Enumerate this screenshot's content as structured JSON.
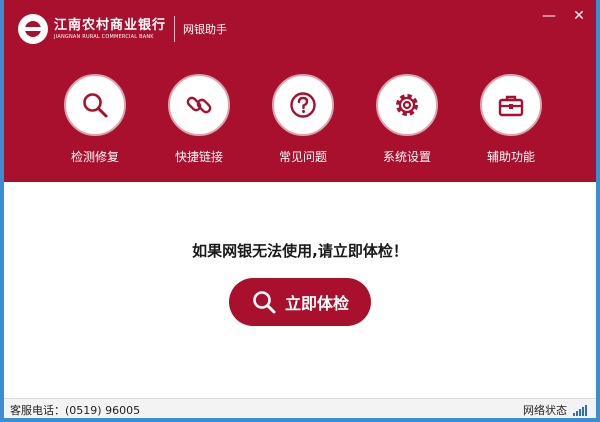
{
  "header": {
    "logo_cn": "江南农村商业银行",
    "logo_en": "JIANGNAN RURAL COMMERCIAL BANK",
    "app_title": "网银助手",
    "min_label": "—",
    "close_label": "✕"
  },
  "nav": {
    "items": [
      {
        "label": "检测修复",
        "icon": "search-icon"
      },
      {
        "label": "快捷链接",
        "icon": "link-icon"
      },
      {
        "label": "常见问题",
        "icon": "question-icon"
      },
      {
        "label": "系统设置",
        "icon": "gear-icon"
      },
      {
        "label": "辅助功能",
        "icon": "toolbox-icon"
      }
    ]
  },
  "main": {
    "headline": "如果网银无法使用,请立即体检！",
    "check_button": "立即体检"
  },
  "status": {
    "phone": "客服电话：(0519) 96005",
    "network": "网络状态"
  },
  "colors": {
    "brand": "#a8102e",
    "window_frame": "#3a8fd0"
  }
}
